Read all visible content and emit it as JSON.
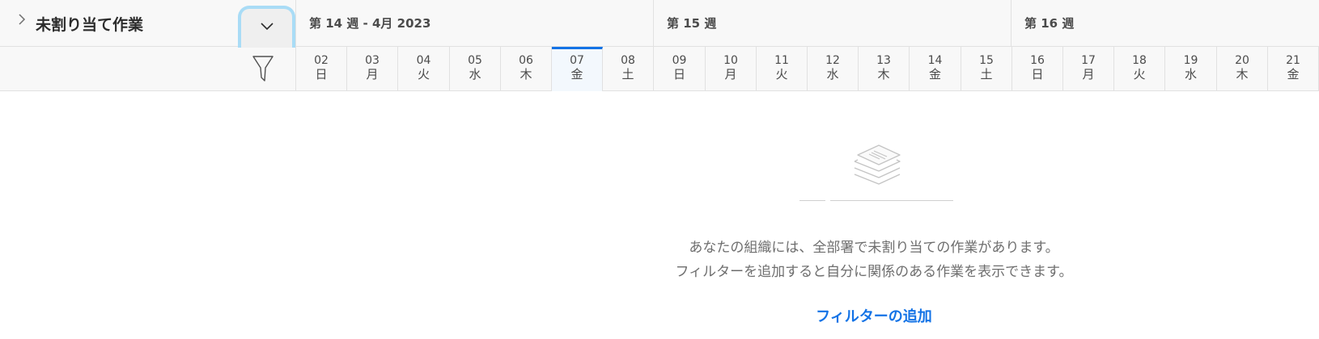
{
  "section": {
    "title": "未割り当て作業"
  },
  "weeks": [
    {
      "label": "第 14 週 - 4月 2023"
    },
    {
      "label": "第 15 週"
    },
    {
      "label": "第 16 週"
    }
  ],
  "days": [
    {
      "num": "02",
      "wd": "日"
    },
    {
      "num": "03",
      "wd": "月"
    },
    {
      "num": "04",
      "wd": "火"
    },
    {
      "num": "05",
      "wd": "水"
    },
    {
      "num": "06",
      "wd": "木"
    },
    {
      "num": "07",
      "wd": "金",
      "today": true
    },
    {
      "num": "08",
      "wd": "土"
    },
    {
      "num": "09",
      "wd": "日"
    },
    {
      "num": "10",
      "wd": "月"
    },
    {
      "num": "11",
      "wd": "火"
    },
    {
      "num": "12",
      "wd": "水"
    },
    {
      "num": "13",
      "wd": "木"
    },
    {
      "num": "14",
      "wd": "金"
    },
    {
      "num": "15",
      "wd": "土"
    },
    {
      "num": "16",
      "wd": "日"
    },
    {
      "num": "17",
      "wd": "月"
    },
    {
      "num": "18",
      "wd": "火"
    },
    {
      "num": "19",
      "wd": "水"
    },
    {
      "num": "20",
      "wd": "木"
    },
    {
      "num": "21",
      "wd": "金"
    }
  ],
  "empty_state": {
    "line1": "あなたの組織には、全部署で未割り当ての作業があります。",
    "line2": "フィルターを追加すると自分に関係のある作業を表示できます。",
    "action": "フィルターの追加"
  },
  "colors": {
    "accent": "#1473e6",
    "focus_ring": "#a9dcf6",
    "today_bg": "#f3f8fd"
  },
  "icons": [
    "chevron-right-icon",
    "chevron-down-icon",
    "filter-icon",
    "stacked-layers-icon"
  ]
}
